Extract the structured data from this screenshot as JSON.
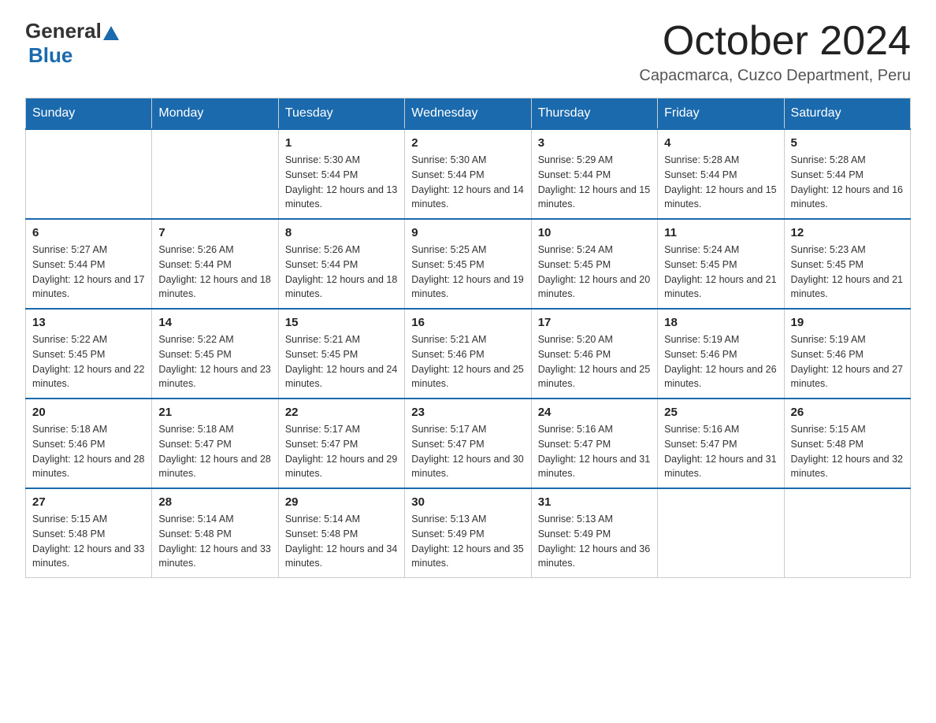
{
  "header": {
    "logo_general": "General",
    "logo_blue": "Blue",
    "month_year": "October 2024",
    "location": "Capacmarca, Cuzco Department, Peru"
  },
  "days_of_week": [
    "Sunday",
    "Monday",
    "Tuesday",
    "Wednesday",
    "Thursday",
    "Friday",
    "Saturday"
  ],
  "weeks": [
    [
      {
        "day": "",
        "info": ""
      },
      {
        "day": "",
        "info": ""
      },
      {
        "day": "1",
        "info": "Sunrise: 5:30 AM\nSunset: 5:44 PM\nDaylight: 12 hours and 13 minutes."
      },
      {
        "day": "2",
        "info": "Sunrise: 5:30 AM\nSunset: 5:44 PM\nDaylight: 12 hours and 14 minutes."
      },
      {
        "day": "3",
        "info": "Sunrise: 5:29 AM\nSunset: 5:44 PM\nDaylight: 12 hours and 15 minutes."
      },
      {
        "day": "4",
        "info": "Sunrise: 5:28 AM\nSunset: 5:44 PM\nDaylight: 12 hours and 15 minutes."
      },
      {
        "day": "5",
        "info": "Sunrise: 5:28 AM\nSunset: 5:44 PM\nDaylight: 12 hours and 16 minutes."
      }
    ],
    [
      {
        "day": "6",
        "info": "Sunrise: 5:27 AM\nSunset: 5:44 PM\nDaylight: 12 hours and 17 minutes."
      },
      {
        "day": "7",
        "info": "Sunrise: 5:26 AM\nSunset: 5:44 PM\nDaylight: 12 hours and 18 minutes."
      },
      {
        "day": "8",
        "info": "Sunrise: 5:26 AM\nSunset: 5:44 PM\nDaylight: 12 hours and 18 minutes."
      },
      {
        "day": "9",
        "info": "Sunrise: 5:25 AM\nSunset: 5:45 PM\nDaylight: 12 hours and 19 minutes."
      },
      {
        "day": "10",
        "info": "Sunrise: 5:24 AM\nSunset: 5:45 PM\nDaylight: 12 hours and 20 minutes."
      },
      {
        "day": "11",
        "info": "Sunrise: 5:24 AM\nSunset: 5:45 PM\nDaylight: 12 hours and 21 minutes."
      },
      {
        "day": "12",
        "info": "Sunrise: 5:23 AM\nSunset: 5:45 PM\nDaylight: 12 hours and 21 minutes."
      }
    ],
    [
      {
        "day": "13",
        "info": "Sunrise: 5:22 AM\nSunset: 5:45 PM\nDaylight: 12 hours and 22 minutes."
      },
      {
        "day": "14",
        "info": "Sunrise: 5:22 AM\nSunset: 5:45 PM\nDaylight: 12 hours and 23 minutes."
      },
      {
        "day": "15",
        "info": "Sunrise: 5:21 AM\nSunset: 5:45 PM\nDaylight: 12 hours and 24 minutes."
      },
      {
        "day": "16",
        "info": "Sunrise: 5:21 AM\nSunset: 5:46 PM\nDaylight: 12 hours and 25 minutes."
      },
      {
        "day": "17",
        "info": "Sunrise: 5:20 AM\nSunset: 5:46 PM\nDaylight: 12 hours and 25 minutes."
      },
      {
        "day": "18",
        "info": "Sunrise: 5:19 AM\nSunset: 5:46 PM\nDaylight: 12 hours and 26 minutes."
      },
      {
        "day": "19",
        "info": "Sunrise: 5:19 AM\nSunset: 5:46 PM\nDaylight: 12 hours and 27 minutes."
      }
    ],
    [
      {
        "day": "20",
        "info": "Sunrise: 5:18 AM\nSunset: 5:46 PM\nDaylight: 12 hours and 28 minutes."
      },
      {
        "day": "21",
        "info": "Sunrise: 5:18 AM\nSunset: 5:47 PM\nDaylight: 12 hours and 28 minutes."
      },
      {
        "day": "22",
        "info": "Sunrise: 5:17 AM\nSunset: 5:47 PM\nDaylight: 12 hours and 29 minutes."
      },
      {
        "day": "23",
        "info": "Sunrise: 5:17 AM\nSunset: 5:47 PM\nDaylight: 12 hours and 30 minutes."
      },
      {
        "day": "24",
        "info": "Sunrise: 5:16 AM\nSunset: 5:47 PM\nDaylight: 12 hours and 31 minutes."
      },
      {
        "day": "25",
        "info": "Sunrise: 5:16 AM\nSunset: 5:47 PM\nDaylight: 12 hours and 31 minutes."
      },
      {
        "day": "26",
        "info": "Sunrise: 5:15 AM\nSunset: 5:48 PM\nDaylight: 12 hours and 32 minutes."
      }
    ],
    [
      {
        "day": "27",
        "info": "Sunrise: 5:15 AM\nSunset: 5:48 PM\nDaylight: 12 hours and 33 minutes."
      },
      {
        "day": "28",
        "info": "Sunrise: 5:14 AM\nSunset: 5:48 PM\nDaylight: 12 hours and 33 minutes."
      },
      {
        "day": "29",
        "info": "Sunrise: 5:14 AM\nSunset: 5:48 PM\nDaylight: 12 hours and 34 minutes."
      },
      {
        "day": "30",
        "info": "Sunrise: 5:13 AM\nSunset: 5:49 PM\nDaylight: 12 hours and 35 minutes."
      },
      {
        "day": "31",
        "info": "Sunrise: 5:13 AM\nSunset: 5:49 PM\nDaylight: 12 hours and 36 minutes."
      },
      {
        "day": "",
        "info": ""
      },
      {
        "day": "",
        "info": ""
      }
    ]
  ]
}
